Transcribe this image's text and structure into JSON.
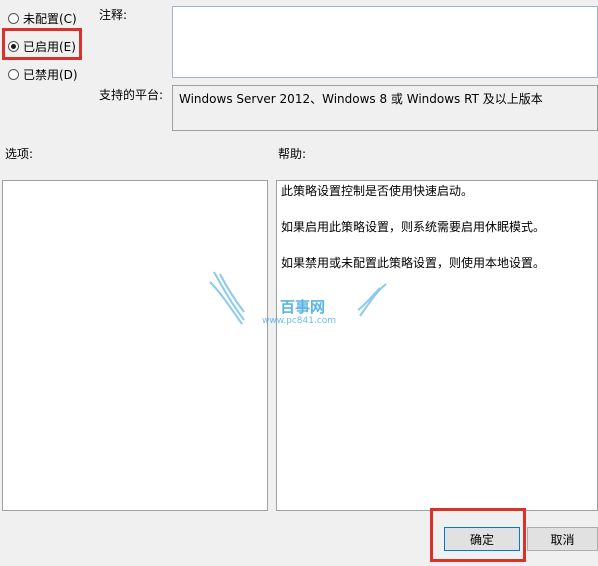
{
  "state": {
    "options": [
      {
        "label": "未配置(C)",
        "checked": false
      },
      {
        "label": "已启用(E)",
        "checked": true
      },
      {
        "label": "已禁用(D)",
        "checked": false
      }
    ]
  },
  "comment": {
    "label": "注释:",
    "value": ""
  },
  "platform": {
    "label": "支持的平台:",
    "value": "Windows Server 2012、Windows 8 或 Windows RT 及以上版本"
  },
  "options_section": {
    "label": "选项:"
  },
  "help_section": {
    "label": "帮助:",
    "paragraphs": [
      "此策略设置控制是否使用快速启动。",
      "如果启用此策略设置，则系统需要启用休眠模式。",
      "如果禁用或未配置此策略设置，则使用本地设置。"
    ]
  },
  "buttons": {
    "ok": "确定",
    "cancel": "取消"
  },
  "watermark": {
    "text": "百事网",
    "url": "www.pc841.com"
  },
  "colors": {
    "highlight": "#d9322a",
    "watermark": "#3fa7e0"
  }
}
